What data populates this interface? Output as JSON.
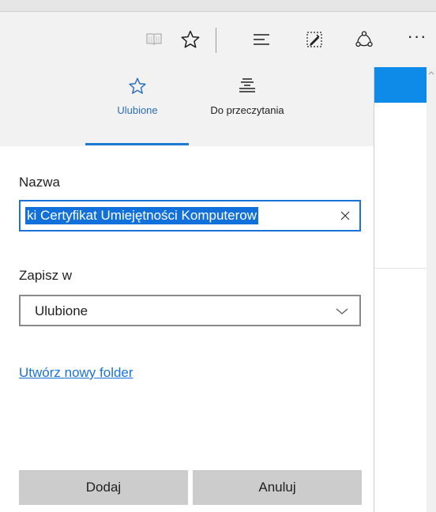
{
  "toolbar": {
    "icons": [
      "reading-view-icon",
      "favorite-star-icon",
      "hub-icon",
      "web-note-icon",
      "share-icon",
      "more-icon"
    ],
    "more_label": "···"
  },
  "hub": {
    "tabs": [
      {
        "label": "Ulubione",
        "icon": "star-icon",
        "active": true
      },
      {
        "label": "Do przeczytania",
        "icon": "reading-list-icon",
        "active": false
      }
    ],
    "accent_color": "#1f7bd2"
  },
  "form": {
    "name_label": "Nazwa",
    "name_value": "ki Certyfikat Umiejętności Komputerow",
    "save_in_label": "Zapisz w",
    "save_in_value": "Ulubione",
    "new_folder_link": "Utwórz nowy folder"
  },
  "buttons": {
    "add_label": "Dodaj",
    "cancel_label": "Anuluj"
  }
}
